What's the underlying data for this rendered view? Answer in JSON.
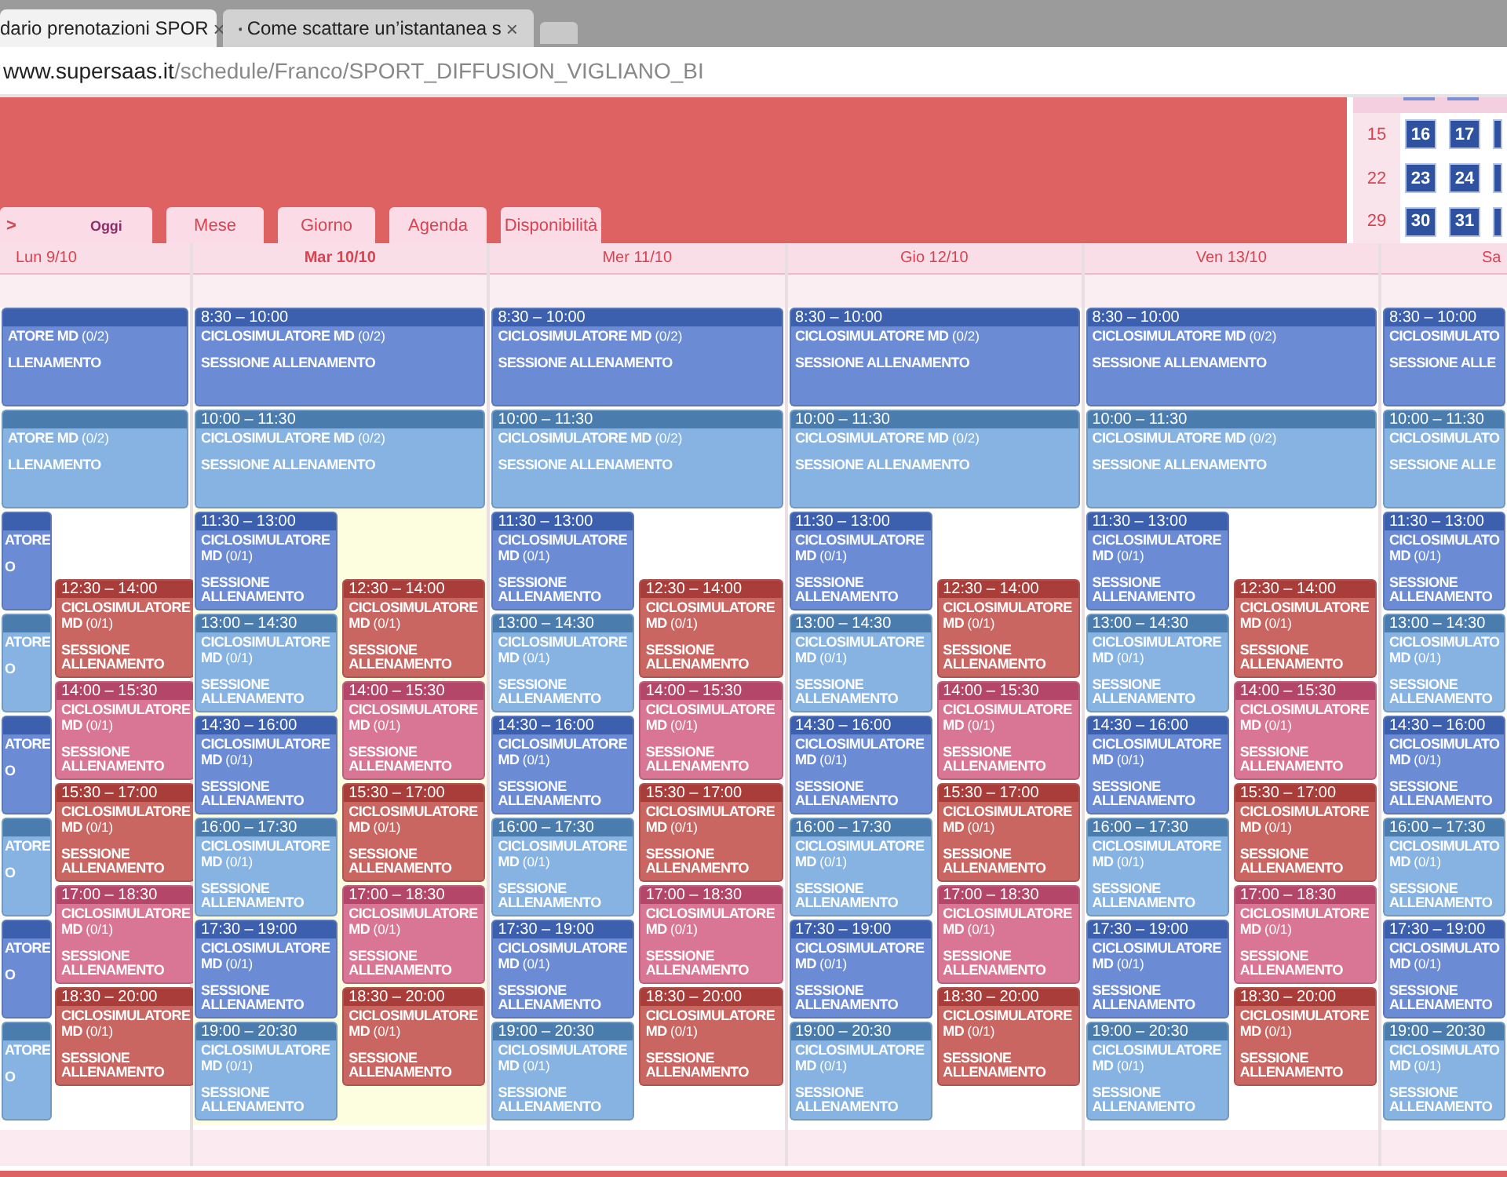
{
  "browser": {
    "tabs": [
      {
        "title": "dario prenotazioni SPOR",
        "close": "×",
        "selected": true
      },
      {
        "title": "Come scattare un’istantanea s",
        "close": "×",
        "selected": false
      }
    ],
    "url": {
      "domain": "www.supersaas.it",
      "path": "/schedule/Franco/SPORT_DIFFUSION_VIGLIANO_BI"
    }
  },
  "nav": {
    "arrow": ">",
    "tabs": [
      {
        "label": "Oggi",
        "selected": false
      },
      {
        "label": "Mese",
        "selected": false
      },
      {
        "label": "Giorno",
        "selected": false
      },
      {
        "label": "Agenda",
        "selected": false
      },
      {
        "label": "Disponibilità",
        "selected": false
      }
    ]
  },
  "mini_calendar": {
    "weeks": [
      {
        "week": "15",
        "days": [
          "16",
          "17"
        ]
      },
      {
        "week": "22",
        "days": [
          "23",
          "24"
        ]
      },
      {
        "week": "29",
        "days": [
          "30",
          "31"
        ]
      }
    ]
  },
  "days": [
    {
      "label": "Lun 9/10",
      "today": false,
      "events": [
        {
          "title": "ATORE MD",
          "capacity": "(0/2)",
          "description": "LLENAMENTO",
          "color": "#6b8cd4"
        },
        {
          "title": "ATORE MD",
          "capacity": "(0/2)",
          "description": "LLENAMENTO",
          "color": "#86b3e1"
        }
      ],
      "lanes": [
        {
          "events": [
            {
              "title": "ATORE",
              "description": "O",
              "color": "#6b8cd4"
            },
            {
              "title": "ATORE",
              "description": "O",
              "color": "#86b3e1"
            },
            {
              "title": "ATORE",
              "description": "O",
              "color": "#6b8cd4"
            },
            {
              "title": "ATORE",
              "description": "O",
              "color": "#86b3e1"
            },
            {
              "title": "ATORE",
              "description": "O",
              "color": "#6b8cd4"
            },
            {
              "title": "ATORE",
              "description": "O",
              "color": "#86b3e1"
            }
          ]
        },
        {
          "events": [
            {
              "time": "12:30 – 14:00",
              "title": "CICLOSIMULATORE MD",
              "capacity": "(0/1)",
              "description": "SESSIONE ALLENAMENTO",
              "color": "#c96662"
            },
            {
              "time": "14:00 – 15:30",
              "title": "CICLOSIMULATORE MD",
              "capacity": "(0/1)",
              "description": "SESSIONE ALLENAMENTO",
              "color": "#d97595"
            },
            {
              "time": "15:30 – 17:00",
              "title": "CICLOSIMULATORE MD",
              "capacity": "(0/1)",
              "description": "SESSIONE ALLENAMENTO",
              "color": "#c96662"
            },
            {
              "time": "17:00 – 18:30",
              "title": "CICLOSIMULATORE MD",
              "capacity": "(0/1)",
              "description": "SESSIONE ALLENAMENTO",
              "color": "#d97595"
            },
            {
              "time": "18:30 – 20:00",
              "title": "CICLOSIMULATORE MD",
              "capacity": "(0/1)",
              "description": "SESSIONE ALLENAMENTO",
              "color": "#c96662"
            }
          ]
        }
      ]
    },
    {
      "label": "Mar 10/10",
      "today": true,
      "events": [
        {
          "time": "8:30 – 10:00",
          "title": "CICLOSIMULATORE MD",
          "capacity": "(0/2)",
          "description": "SESSIONE ALLENAMENTO",
          "color": "#6b8cd4"
        },
        {
          "time": "10:00 – 11:30",
          "title": "CICLOSIMULATORE MD",
          "capacity": "(0/2)",
          "description": "SESSIONE ALLENAMENTO",
          "color": "#86b3e1"
        }
      ],
      "lanes": [
        {
          "events": [
            {
              "time": "11:30 – 13:00",
              "title": "CICLOSIMULATORE MD",
              "capacity": "(0/1)",
              "description": "SESSIONE ALLENAMENTO",
              "color": "#6b8cd4"
            },
            {
              "time": "13:00 – 14:30",
              "title": "CICLOSIMULATORE MD",
              "capacity": "(0/1)",
              "description": "SESSIONE ALLENAMENTO",
              "color": "#86b3e1"
            },
            {
              "time": "14:30 – 16:00",
              "title": "CICLOSIMULATORE MD",
              "capacity": "(0/1)",
              "description": "SESSIONE ALLENAMENTO",
              "color": "#6b8cd4"
            },
            {
              "time": "16:00 – 17:30",
              "title": "CICLOSIMULATORE MD",
              "capacity": "(0/1)",
              "description": "SESSIONE ALLENAMENTO",
              "color": "#86b3e1"
            },
            {
              "time": "17:30 – 19:00",
              "title": "CICLOSIMULATORE MD",
              "capacity": "(0/1)",
              "description": "SESSIONE ALLENAMENTO",
              "color": "#6b8cd4"
            },
            {
              "time": "19:00 – 20:30",
              "title": "CICLOSIMULATORE MD",
              "capacity": "(0/1)",
              "description": "SESSIONE ALLENAMENTO",
              "color": "#86b3e1"
            }
          ]
        },
        {
          "events": [
            {
              "time": "12:30 – 14:00",
              "title": "CICLOSIMULATORE MD",
              "capacity": "(0/1)",
              "description": "SESSIONE ALLENAMENTO",
              "color": "#c96662"
            },
            {
              "time": "14:00 – 15:30",
              "title": "CICLOSIMULATORE MD",
              "capacity": "(0/1)",
              "description": "SESSIONE ALLENAMENTO",
              "color": "#d97595"
            },
            {
              "time": "15:30 – 17:00",
              "title": "CICLOSIMULATORE MD",
              "capacity": "(0/1)",
              "description": "SESSIONE ALLENAMENTO",
              "color": "#c96662"
            },
            {
              "time": "17:00 – 18:30",
              "title": "CICLOSIMULATORE MD",
              "capacity": "(0/1)",
              "description": "SESSIONE ALLENAMENTO",
              "color": "#d97595"
            },
            {
              "time": "18:30 – 20:00",
              "title": "CICLOSIMULATORE MD",
              "capacity": "(0/1)",
              "description": "SESSIONE ALLENAMENTO",
              "color": "#c96662"
            }
          ]
        }
      ]
    },
    {
      "label": "Mer 11/10",
      "today": false,
      "events": [
        {
          "time": "8:30 – 10:00",
          "title": "CICLOSIMULATORE MD",
          "capacity": "(0/2)",
          "description": "SESSIONE ALLENAMENTO",
          "color": "#6b8cd4"
        },
        {
          "time": "10:00 – 11:30",
          "title": "CICLOSIMULATORE MD",
          "capacity": "(0/2)",
          "description": "SESSIONE ALLENAMENTO",
          "color": "#86b3e1"
        }
      ],
      "lanes": [
        {
          "events": [
            {
              "time": "11:30 – 13:00",
              "title": "CICLOSIMULATORE MD",
              "capacity": "(0/1)",
              "description": "SESSIONE ALLENAMENTO",
              "color": "#6b8cd4"
            },
            {
              "time": "13:00 – 14:30",
              "title": "CICLOSIMULATORE MD",
              "capacity": "(0/1)",
              "description": "SESSIONE ALLENAMENTO",
              "color": "#86b3e1"
            },
            {
              "time": "14:30 – 16:00",
              "title": "CICLOSIMULATORE MD",
              "capacity": "(0/1)",
              "description": "SESSIONE ALLENAMENTO",
              "color": "#6b8cd4"
            },
            {
              "time": "16:00 – 17:30",
              "title": "CICLOSIMULATORE MD",
              "capacity": "(0/1)",
              "description": "SESSIONE ALLENAMENTO",
              "color": "#86b3e1"
            },
            {
              "time": "17:30 – 19:00",
              "title": "CICLOSIMULATORE MD",
              "capacity": "(0/1)",
              "description": "SESSIONE ALLENAMENTO",
              "color": "#6b8cd4"
            },
            {
              "time": "19:00 – 20:30",
              "title": "CICLOSIMULATORE MD",
              "capacity": "(0/1)",
              "description": "SESSIONE ALLENAMENTO",
              "color": "#86b3e1"
            }
          ]
        },
        {
          "events": [
            {
              "time": "12:30 – 14:00",
              "title": "CICLOSIMULATORE MD",
              "capacity": "(0/1)",
              "description": "SESSIONE ALLENAMENTO",
              "color": "#c96662"
            },
            {
              "time": "14:00 – 15:30",
              "title": "CICLOSIMULATORE MD",
              "capacity": "(0/1)",
              "description": "SESSIONE ALLENAMENTO",
              "color": "#d97595"
            },
            {
              "time": "15:30 – 17:00",
              "title": "CICLOSIMULATORE MD",
              "capacity": "(0/1)",
              "description": "SESSIONE ALLENAMENTO",
              "color": "#c96662"
            },
            {
              "time": "17:00 – 18:30",
              "title": "CICLOSIMULATORE MD",
              "capacity": "(0/1)",
              "description": "SESSIONE ALLENAMENTO",
              "color": "#d97595"
            },
            {
              "time": "18:30 – 20:00",
              "title": "CICLOSIMULATORE MD",
              "capacity": "(0/1)",
              "description": "SESSIONE ALLENAMENTO",
              "color": "#c96662"
            }
          ]
        }
      ]
    },
    {
      "label": "Gio 12/10",
      "today": false,
      "events": [
        {
          "time": "8:30 – 10:00",
          "title": "CICLOSIMULATORE MD",
          "capacity": "(0/2)",
          "description": "SESSIONE ALLENAMENTO",
          "color": "#6b8cd4"
        },
        {
          "time": "10:00 – 11:30",
          "title": "CICLOSIMULATORE MD",
          "capacity": "(0/2)",
          "description": "SESSIONE ALLENAMENTO",
          "color": "#86b3e1"
        }
      ],
      "lanes": [
        {
          "events": [
            {
              "time": "11:30 – 13:00",
              "title": "CICLOSIMULATORE MD",
              "capacity": "(0/1)",
              "description": "SESSIONE ALLENAMENTO",
              "color": "#6b8cd4"
            },
            {
              "time": "13:00 – 14:30",
              "title": "CICLOSIMULATORE MD",
              "capacity": "(0/1)",
              "description": "SESSIONE ALLENAMENTO",
              "color": "#86b3e1"
            },
            {
              "time": "14:30 – 16:00",
              "title": "CICLOSIMULATORE MD",
              "capacity": "(0/1)",
              "description": "SESSIONE ALLENAMENTO",
              "color": "#6b8cd4"
            },
            {
              "time": "16:00 – 17:30",
              "title": "CICLOSIMULATORE MD",
              "capacity": "(0/1)",
              "description": "SESSIONE ALLENAMENTO",
              "color": "#86b3e1"
            },
            {
              "time": "17:30 – 19:00",
              "title": "CICLOSIMULATORE MD",
              "capacity": "(0/1)",
              "description": "SESSIONE ALLENAMENTO",
              "color": "#6b8cd4"
            },
            {
              "time": "19:00 – 20:30",
              "title": "CICLOSIMULATORE MD",
              "capacity": "(0/1)",
              "description": "SESSIONE ALLENAMENTO",
              "color": "#86b3e1"
            }
          ]
        },
        {
          "events": [
            {
              "time": "12:30 – 14:00",
              "title": "CICLOSIMULATORE MD",
              "capacity": "(0/1)",
              "description": "SESSIONE ALLENAMENTO",
              "color": "#c96662"
            },
            {
              "time": "14:00 – 15:30",
              "title": "CICLOSIMULATORE MD",
              "capacity": "(0/1)",
              "description": "SESSIONE ALLENAMENTO",
              "color": "#d97595"
            },
            {
              "time": "15:30 – 17:00",
              "title": "CICLOSIMULATORE MD",
              "capacity": "(0/1)",
              "description": "SESSIONE ALLENAMENTO",
              "color": "#c96662"
            },
            {
              "time": "17:00 – 18:30",
              "title": "CICLOSIMULATORE MD",
              "capacity": "(0/1)",
              "description": "SESSIONE ALLENAMENTO",
              "color": "#d97595"
            },
            {
              "time": "18:30 – 20:00",
              "title": "CICLOSIMULATORE MD",
              "capacity": "(0/1)",
              "description": "SESSIONE ALLENAMENTO",
              "color": "#c96662"
            }
          ]
        }
      ]
    },
    {
      "label": "Ven 13/10",
      "today": false,
      "events": [
        {
          "time": "8:30 – 10:00",
          "title": "CICLOSIMULATORE MD",
          "capacity": "(0/2)",
          "description": "SESSIONE ALLENAMENTO",
          "color": "#6b8cd4"
        },
        {
          "time": "10:00 – 11:30",
          "title": "CICLOSIMULATORE MD",
          "capacity": "(0/2)",
          "description": "SESSIONE ALLENAMENTO",
          "color": "#86b3e1"
        }
      ],
      "lanes": [
        {
          "events": [
            {
              "time": "11:30 – 13:00",
              "title": "CICLOSIMULATORE MD",
              "capacity": "(0/1)",
              "description": "SESSIONE ALLENAMENTO",
              "color": "#6b8cd4"
            },
            {
              "time": "13:00 – 14:30",
              "title": "CICLOSIMULATORE MD",
              "capacity": "(0/1)",
              "description": "SESSIONE ALLENAMENTO",
              "color": "#86b3e1"
            },
            {
              "time": "14:30 – 16:00",
              "title": "CICLOSIMULATORE MD",
              "capacity": "(0/1)",
              "description": "SESSIONE ALLENAMENTO",
              "color": "#6b8cd4"
            },
            {
              "time": "16:00 – 17:30",
              "title": "CICLOSIMULATORE MD",
              "capacity": "(0/1)",
              "description": "SESSIONE ALLENAMENTO",
              "color": "#86b3e1"
            },
            {
              "time": "17:30 – 19:00",
              "title": "CICLOSIMULATORE MD",
              "capacity": "(0/1)",
              "description": "SESSIONE ALLENAMENTO",
              "color": "#6b8cd4"
            },
            {
              "time": "19:00 – 20:30",
              "title": "CICLOSIMULATORE MD",
              "capacity": "(0/1)",
              "description": "SESSIONE ALLENAMENTO",
              "color": "#86b3e1"
            }
          ]
        },
        {
          "events": [
            {
              "time": "12:30 – 14:00",
              "title": "CICLOSIMULATORE MD",
              "capacity": "(0/1)",
              "description": "SESSIONE ALLENAMENTO",
              "color": "#c96662"
            },
            {
              "time": "14:00 – 15:30",
              "title": "CICLOSIMULATORE MD",
              "capacity": "(0/1)",
              "description": "SESSIONE ALLENAMENTO",
              "color": "#d97595"
            },
            {
              "time": "15:30 – 17:00",
              "title": "CICLOSIMULATORE MD",
              "capacity": "(0/1)",
              "description": "SESSIONE ALLENAMENTO",
              "color": "#c96662"
            },
            {
              "time": "17:00 – 18:30",
              "title": "CICLOSIMULATORE MD",
              "capacity": "(0/1)",
              "description": "SESSIONE ALLENAMENTO",
              "color": "#d97595"
            },
            {
              "time": "18:30 – 20:00",
              "title": "CICLOSIMULATORE MD",
              "capacity": "(0/1)",
              "description": "SESSIONE ALLENAMENTO",
              "color": "#c96662"
            }
          ]
        }
      ]
    },
    {
      "label": "Sa",
      "today": false,
      "events": [
        {
          "time": "8:30 – 10:00",
          "title": "CICLOSIMULATO",
          "description": "SESSIONE ALLE",
          "color": "#6b8cd4"
        },
        {
          "time": "10:00 – 11:30",
          "title": "CICLOSIMULATO",
          "description": "SESSIONE ALLE",
          "color": "#86b3e1"
        }
      ],
      "lanes": [
        {
          "events": [
            {
              "time": "11:30 – 13:00",
              "title": "CICLOSIMULATO MD",
              "capacity": "(0/1)",
              "description": "SESSIONE ALLENAMENTO",
              "color": "#6b8cd4"
            },
            {
              "time": "13:00 – 14:30",
              "title": "CICLOSIMULATO MD",
              "capacity": "(0/1)",
              "description": "SESSIONE ALLENAMENTO",
              "color": "#86b3e1"
            },
            {
              "time": "14:30 – 16:00",
              "title": "CICLOSIMULATO MD",
              "capacity": "(0/1)",
              "description": "SESSIONE ALLENAMENTO",
              "color": "#6b8cd4"
            },
            {
              "time": "16:00 – 17:30",
              "title": "CICLOSIMULATO MD",
              "capacity": "(0/1)",
              "description": "SESSIONE ALLENAMENTO",
              "color": "#86b3e1"
            },
            {
              "time": "17:30 – 19:00",
              "title": "CICLOSIMULATO MD",
              "capacity": "(0/1)",
              "description": "SESSIONE ALLENAMENTO",
              "color": "#6b8cd4"
            },
            {
              "time": "19:00 – 20:30",
              "title": "CICLOSIMULATO MD",
              "capacity": "(0/1)",
              "description": "SESSIONE ALLENAMENTO",
              "color": "#86b3e1"
            }
          ]
        }
      ]
    }
  ]
}
